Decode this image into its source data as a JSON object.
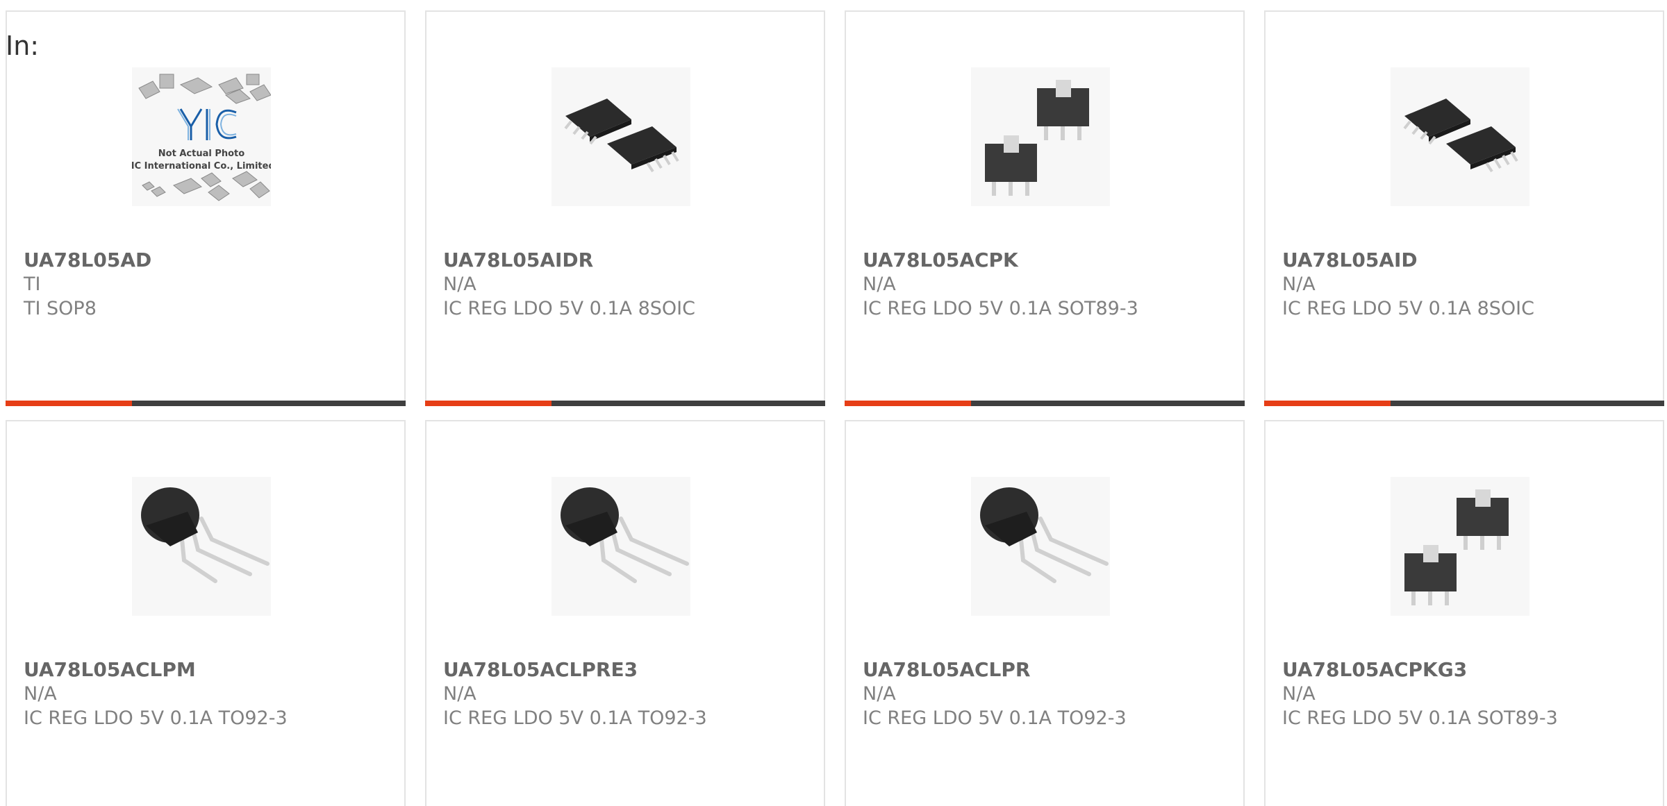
{
  "filter_label": "In:",
  "colors": {
    "accent": "#e63e16",
    "bar": "#3f3f3f",
    "border": "#e3e3e3"
  },
  "placeholder": {
    "line1": "Not Actual Photo",
    "line2": "YIC International Co., Limited."
  },
  "products": [
    {
      "part_number": "UA78L05AD",
      "manufacturer": "TI",
      "description": "TI SOP8",
      "image": "yic-placeholder-icon"
    },
    {
      "part_number": "UA78L05AIDR",
      "manufacturer": "N/A",
      "description": "IC REG LDO 5V 0.1A 8SOIC",
      "image": "soic8-chip-icon"
    },
    {
      "part_number": "UA78L05ACPK",
      "manufacturer": "N/A",
      "description": "IC REG LDO 5V 0.1A SOT89-3",
      "image": "sot89-chip-icon"
    },
    {
      "part_number": "UA78L05AID",
      "manufacturer": "N/A",
      "description": "IC REG LDO 5V 0.1A 8SOIC",
      "image": "soic8-chip-icon"
    },
    {
      "part_number": "UA78L05ACLPM",
      "manufacturer": "N/A",
      "description": "IC REG LDO 5V 0.1A TO92-3",
      "image": "to92-transistor-icon"
    },
    {
      "part_number": "UA78L05ACLPRE3",
      "manufacturer": "N/A",
      "description": "IC REG LDO 5V 0.1A TO92-3",
      "image": "to92-transistor-icon"
    },
    {
      "part_number": "UA78L05ACLPR",
      "manufacturer": "N/A",
      "description": "IC REG LDO 5V 0.1A TO92-3",
      "image": "to92-transistor-icon"
    },
    {
      "part_number": "UA78L05ACPKG3",
      "manufacturer": "N/A",
      "description": "IC REG LDO 5V 0.1A SOT89-3",
      "image": "sot89-chip-icon"
    }
  ]
}
